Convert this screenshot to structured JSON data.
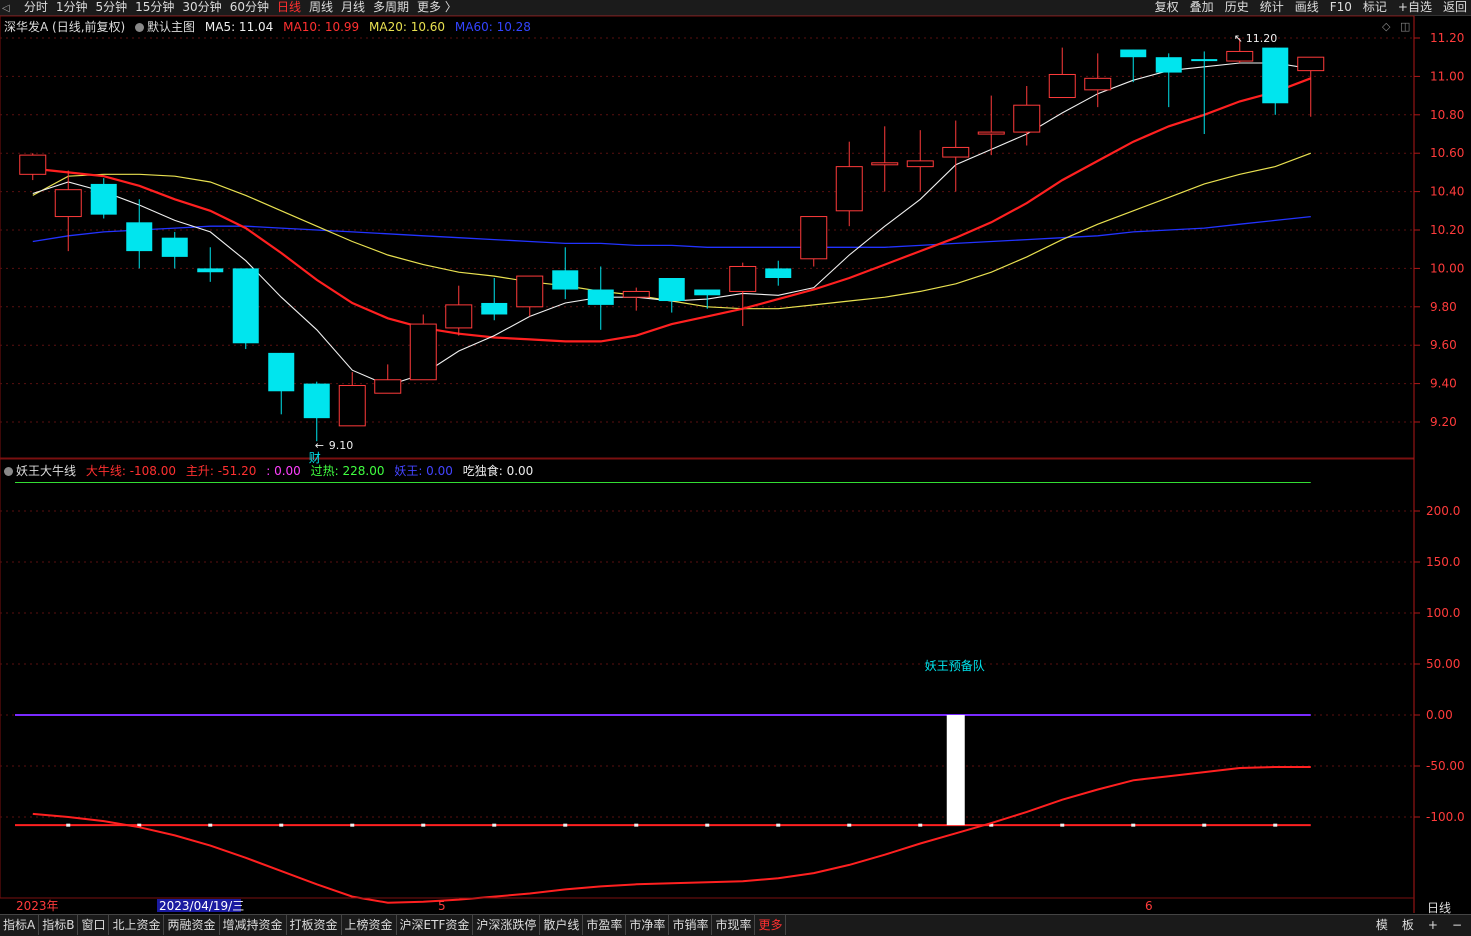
{
  "topbar": {
    "left_items": [
      "分时",
      "1分钟",
      "5分钟",
      "15分钟",
      "30分钟",
      "60分钟",
      "日线",
      "周线",
      "月线",
      "多周期",
      "更多 〉"
    ],
    "active": "日线",
    "right_items": [
      "复权",
      "叠加",
      "历史",
      "统计",
      "画线",
      "F10",
      "标记",
      "+自选",
      "返回"
    ]
  },
  "main_info": {
    "stock": "深华发A (日线,前复权)",
    "template": "默认主图",
    "ma5": "MA5: 11.04",
    "ma10": "MA10: 10.99",
    "ma20": "MA20: 10.60",
    "ma60": "MA60: 10.28"
  },
  "sub_info": {
    "indicator": "妖王大牛线",
    "v1": "大牛线: -108.00",
    "v2": "主升: -51.20",
    "v3": ": 0.00",
    "v4": "过热: 228.00",
    "v5": "妖王: 0.00",
    "v6": "吃独食: 0.00"
  },
  "annotations": {
    "high": "11.20",
    "low": "9.10",
    "cai": "财",
    "yaowang": "妖王预备队"
  },
  "price_axis": [
    "11.20",
    "11.00",
    "10.80",
    "10.60",
    "10.40",
    "10.20",
    "10.00",
    "9.80",
    "9.60",
    "9.40",
    "9.20"
  ],
  "sub_axis": [
    "200.0",
    "150.0",
    "100.0",
    "50.00",
    "0.00",
    "-50.00",
    "-100.0"
  ],
  "dates": {
    "year": "2023年",
    "selected": "2023/04/19/三",
    "m5": "5",
    "m6": "6"
  },
  "period": "日线",
  "bottombar": {
    "tabs": [
      "指标A",
      "指标B",
      "窗口",
      "北上资金",
      "两融资金",
      "增减持资金",
      "打板资金",
      "上榜资金",
      "沪深ETF资金",
      "沪深涨跌停",
      "散户线",
      "市盈率",
      "市净率",
      "市销率",
      "市现率"
    ],
    "more": "更多",
    "right": [
      "模",
      "板",
      "+",
      "−"
    ]
  },
  "colors": {
    "up": "#ff3b3b",
    "down": "#00e5ee",
    "ma5": "#f0f0f0",
    "ma10": "#ff2020",
    "ma20": "#e8e050",
    "ma60": "#2233ff"
  },
  "chart_data": {
    "type": "candlestick",
    "candles": [
      {
        "o": 10.49,
        "c": 10.59,
        "h": 10.6,
        "l": 10.46
      },
      {
        "o": 10.27,
        "c": 10.41,
        "h": 10.51,
        "l": 10.09
      },
      {
        "o": 10.44,
        "c": 10.28,
        "h": 10.47,
        "l": 10.26
      },
      {
        "o": 10.24,
        "c": 10.09,
        "h": 10.36,
        "l": 10.0
      },
      {
        "o": 10.16,
        "c": 10.06,
        "h": 10.19,
        "l": 10.0
      },
      {
        "o": 10.0,
        "c": 9.98,
        "h": 10.11,
        "l": 9.93
      },
      {
        "o": 10.0,
        "c": 9.61,
        "h": 10.0,
        "l": 9.58
      },
      {
        "o": 9.56,
        "c": 9.36,
        "h": 9.56,
        "l": 9.24
      },
      {
        "o": 9.4,
        "c": 9.22,
        "h": 9.41,
        "l": 9.1
      },
      {
        "o": 9.18,
        "c": 9.39,
        "h": 9.46,
        "l": 9.18
      },
      {
        "o": 9.35,
        "c": 9.42,
        "h": 9.5,
        "l": 9.35
      },
      {
        "o": 9.42,
        "c": 9.71,
        "h": 9.76,
        "l": 9.42
      },
      {
        "o": 9.69,
        "c": 9.81,
        "h": 9.91,
        "l": 9.65
      },
      {
        "o": 9.82,
        "c": 9.76,
        "h": 9.95,
        "l": 9.73
      },
      {
        "o": 9.8,
        "c": 9.96,
        "h": 9.96,
        "l": 9.75
      },
      {
        "o": 9.99,
        "c": 9.89,
        "h": 10.11,
        "l": 9.84
      },
      {
        "o": 9.89,
        "c": 9.81,
        "h": 10.01,
        "l": 9.68
      },
      {
        "o": 9.85,
        "c": 9.88,
        "h": 9.9,
        "l": 9.78
      },
      {
        "o": 9.95,
        "c": 9.83,
        "h": 9.95,
        "l": 9.77
      },
      {
        "o": 9.89,
        "c": 9.86,
        "h": 9.88,
        "l": 9.79
      },
      {
        "o": 9.88,
        "c": 10.01,
        "h": 10.03,
        "l": 9.7
      },
      {
        "o": 10.0,
        "c": 9.95,
        "h": 10.04,
        "l": 9.91
      },
      {
        "o": 10.05,
        "c": 10.27,
        "h": 10.27,
        "l": 10.01
      },
      {
        "o": 10.3,
        "c": 10.53,
        "h": 10.66,
        "l": 10.22
      },
      {
        "o": 10.55,
        "c": 10.55,
        "h": 10.74,
        "l": 10.4
      },
      {
        "o": 10.53,
        "c": 10.56,
        "h": 10.72,
        "l": 10.4
      },
      {
        "o": 10.58,
        "c": 10.63,
        "h": 10.77,
        "l": 10.4
      },
      {
        "o": 10.71,
        "c": 10.71,
        "h": 10.9,
        "l": 10.59
      },
      {
        "o": 10.71,
        "c": 10.85,
        "h": 10.95,
        "l": 10.64
      },
      {
        "o": 10.89,
        "c": 11.01,
        "h": 11.15,
        "l": 10.89
      },
      {
        "o": 10.93,
        "c": 10.99,
        "h": 11.12,
        "l": 10.84
      },
      {
        "o": 11.14,
        "c": 11.1,
        "h": 11.14,
        "l": 10.97
      },
      {
        "o": 11.1,
        "c": 11.02,
        "h": 11.12,
        "l": 10.84
      },
      {
        "o": 11.09,
        "c": 11.08,
        "h": 11.13,
        "l": 10.7
      },
      {
        "o": 11.08,
        "c": 11.13,
        "h": 11.2,
        "l": 11.07
      },
      {
        "o": 11.15,
        "c": 10.86,
        "h": 11.15,
        "l": 10.8
      },
      {
        "o": 11.03,
        "c": 11.1,
        "h": 11.1,
        "l": 10.79
      }
    ],
    "ma5": [
      10.39,
      10.45,
      10.4,
      10.33,
      10.25,
      10.19,
      10.04,
      9.85,
      9.68,
      9.47,
      9.39,
      9.45,
      9.57,
      9.65,
      9.75,
      9.82,
      9.85,
      9.85,
      9.83,
      9.84,
      9.87,
      9.86,
      9.9,
      10.07,
      10.22,
      10.36,
      10.54,
      10.62,
      10.7,
      10.81,
      10.91,
      10.98,
      11.03,
      11.05,
      11.07,
      11.07,
      11.04
    ],
    "ma10": [
      10.52,
      10.5,
      10.48,
      10.43,
      10.36,
      10.3,
      10.21,
      10.08,
      9.94,
      9.82,
      9.74,
      9.69,
      9.66,
      9.64,
      9.63,
      9.62,
      9.62,
      9.65,
      9.71,
      9.75,
      9.79,
      9.84,
      9.89,
      9.95,
      10.02,
      10.09,
      10.16,
      10.24,
      10.34,
      10.46,
      10.56,
      10.66,
      10.74,
      10.8,
      10.87,
      10.92,
      10.99
    ],
    "ma20": [
      10.38,
      10.48,
      10.49,
      10.49,
      10.48,
      10.45,
      10.38,
      10.3,
      10.22,
      10.14,
      10.07,
      10.02,
      9.98,
      9.96,
      9.93,
      9.91,
      9.88,
      9.86,
      9.83,
      9.8,
      9.79,
      9.79,
      9.81,
      9.83,
      9.85,
      9.88,
      9.92,
      9.98,
      10.06,
      10.15,
      10.23,
      10.3,
      10.37,
      10.44,
      10.49,
      10.53,
      10.6
    ],
    "ma60": [
      10.14,
      10.17,
      10.19,
      10.2,
      10.21,
      10.22,
      10.22,
      10.21,
      10.2,
      10.19,
      10.18,
      10.17,
      10.16,
      10.15,
      10.14,
      10.13,
      10.13,
      10.12,
      10.12,
      10.11,
      10.11,
      10.11,
      10.11,
      10.11,
      10.11,
      10.12,
      10.13,
      10.14,
      10.15,
      10.16,
      10.17,
      10.19,
      10.2,
      10.21,
      10.23,
      10.25,
      10.27
    ],
    "price_range": [
      9.1,
      11.2
    ],
    "sub": {
      "guore": 228,
      "yaowang_line": 0,
      "daniu": -108,
      "zhusheng": [
        -97,
        -100,
        -104,
        -110,
        -118,
        -128,
        -140,
        -153,
        -166,
        -178,
        -184,
        -183,
        -181,
        -178,
        -175,
        -171,
        -168,
        -166,
        -165,
        -164,
        -163,
        -160,
        -155,
        -147,
        -137,
        -126,
        -116,
        -106,
        -95,
        -83,
        -73,
        -64,
        -60,
        -56,
        -52,
        -51,
        -51
      ],
      "bar_index": 26,
      "range": [
        -170,
        240
      ]
    }
  }
}
